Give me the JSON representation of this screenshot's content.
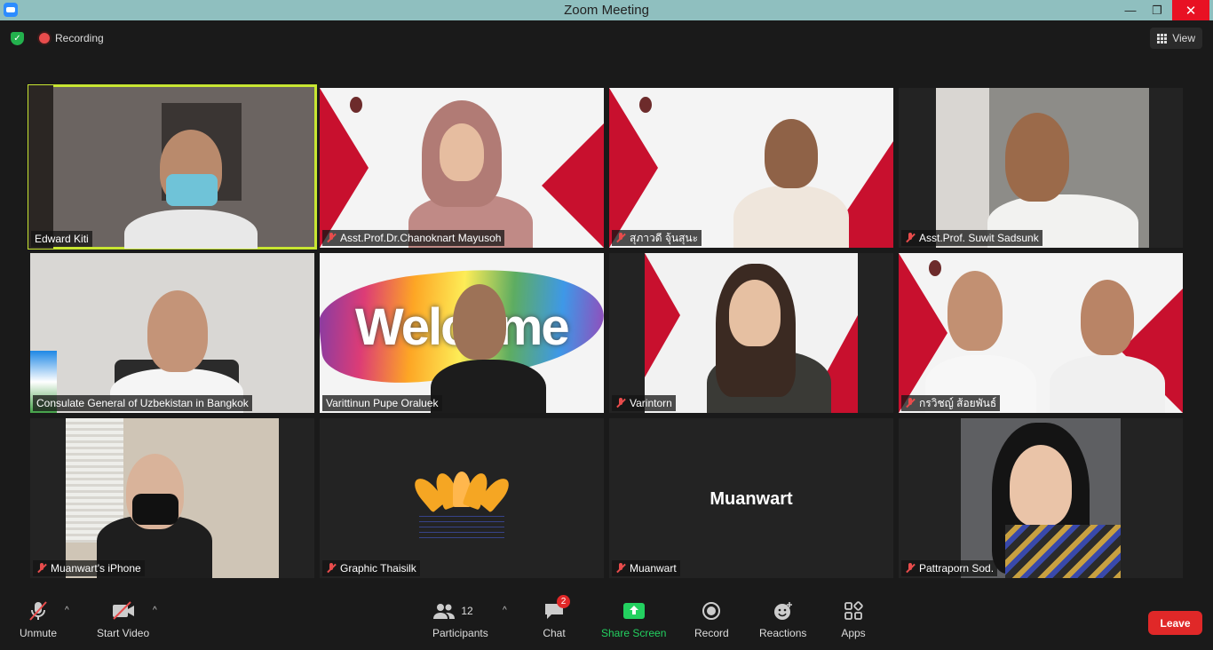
{
  "window": {
    "title": "Zoom Meeting"
  },
  "topbar": {
    "recording_label": "Recording",
    "view_label": "View"
  },
  "participants": [
    {
      "name": "Edward Kiti",
      "muted": false,
      "active_speaker": true
    },
    {
      "name": "Asst.Prof.Dr.Chanoknart Mayusoh",
      "muted": true
    },
    {
      "name": "สุภาวดี จุ้นสุนะ",
      "muted": true
    },
    {
      "name": "Asst.Prof. Suwit Sadsunk",
      "muted": true
    },
    {
      "name": "Consulate General of Uzbekistan in Bangkok",
      "muted": false
    },
    {
      "name": "Varittinun Pupe Oraluek",
      "muted": false
    },
    {
      "name": "Varintorn",
      "muted": true
    },
    {
      "name": "กรวิชญ์ ส้อยพันธ์",
      "muted": true
    },
    {
      "name": "Muanwart's iPhone",
      "muted": true
    },
    {
      "name": "Graphic Thaisilk",
      "muted": true
    },
    {
      "name": "Muanwart",
      "muted": true,
      "video_off_name": "Muanwart"
    },
    {
      "name": "Pattraporn Sod.",
      "muted": true
    }
  ],
  "tiles_text": {
    "welcome": "Welcome"
  },
  "toolbar": {
    "unmute": "Unmute",
    "start_video": "Start Video",
    "participants": "Participants",
    "participants_count": "12",
    "chat": "Chat",
    "chat_badge": "2",
    "share_screen": "Share Screen",
    "record": "Record",
    "reactions": "Reactions",
    "apps": "Apps",
    "leave": "Leave"
  },
  "colors": {
    "active_border": "#c8e632",
    "share_green": "#23d160",
    "leave_red": "#e02828",
    "titlebar": "#8fbfbf"
  }
}
